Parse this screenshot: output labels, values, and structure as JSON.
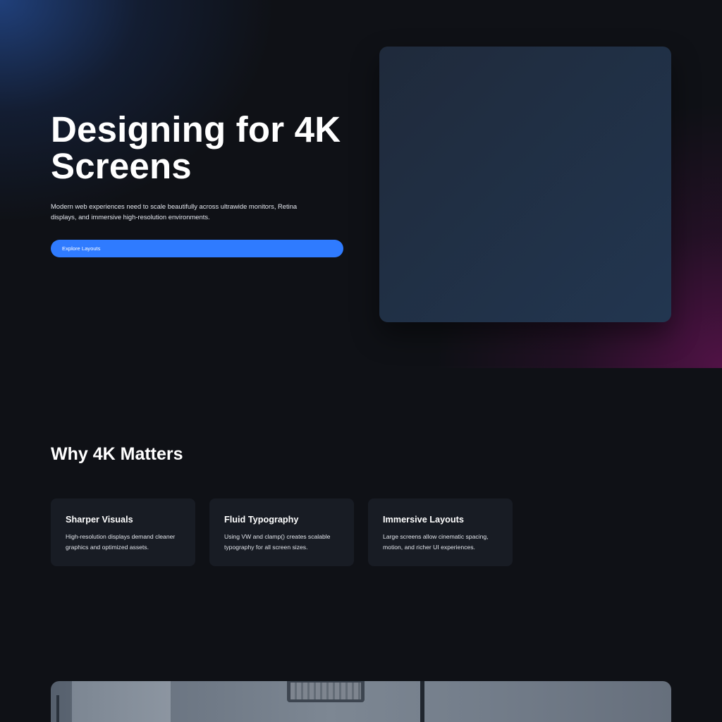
{
  "hero": {
    "title": "Designing for 4K Screens",
    "subtitle": "Modern web experiences need to scale beautifully across ultrawide monitors, Retina displays, and immersive high-resolution environments.",
    "cta_label": "Explore Layouts"
  },
  "features_section": {
    "title": "Why 4K Matters",
    "items": [
      {
        "title": "Sharper Visuals",
        "text": "High-resolution displays demand cleaner graphics and optimized assets."
      },
      {
        "title": "Fluid Typography",
        "text": "Using VW and clamp() creates scalable typography for all screen sizes."
      },
      {
        "title": "Immersive Layouts",
        "text": "Large screens allow cinematic spacing, motion, and richer UI experiences."
      }
    ]
  },
  "colors": {
    "background": "#0f1116",
    "accent": "#2f7bff",
    "card": "#181c24",
    "hero_glow_blue": "#23488c",
    "hero_glow_magenta": "#5c124e"
  }
}
